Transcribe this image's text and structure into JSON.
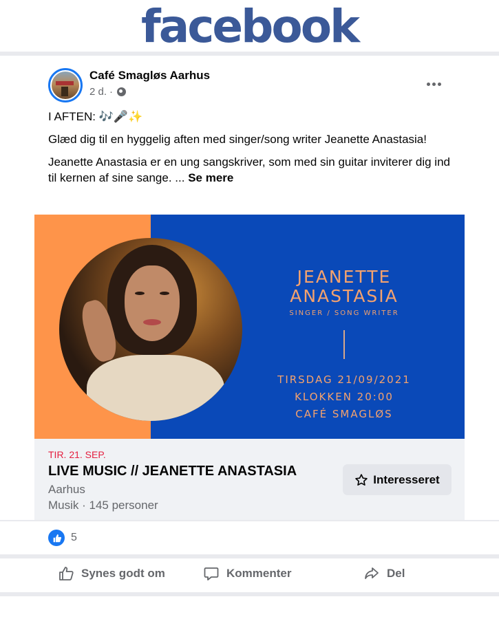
{
  "header": {
    "logo_text": "facebook",
    "logo_color": "#3b5998"
  },
  "post": {
    "page_name": "Café Smagløs Aarhus",
    "time": "2 d.",
    "separator": "·",
    "audience_icon": "globe-icon",
    "text": [
      "I AFTEN: 🎶🎤✨",
      "Glæd dig til en hyggelig aften med singer/song writer Jeanette Anastasia!",
      "Jeanette Anastasia er en ung sangskriver, som med sin guitar inviterer dig ind til kernen af sine sange. ..."
    ],
    "see_more": "Se mere"
  },
  "image": {
    "name_line1": "JEANETTE",
    "name_line2": "ANASTASIA",
    "role": "SINGER / SONG WRITER",
    "date_line": "TIRSDAG 21/09/2021",
    "time_line": "KLOKKEN 20:00",
    "place_line": "CAFÉ SMAGLØS",
    "colors": {
      "orange": "#fe944a",
      "blue": "#0a49b8",
      "text": "#f4a26e"
    }
  },
  "event": {
    "date": "TIR. 21. SEP.",
    "title": "LIVE MUSIC // JEANETTE ANASTASIA",
    "location": "Aarhus",
    "category": "Musik · 145 personer",
    "interested_label": "Interesseret"
  },
  "reactions": {
    "count": "5",
    "icon": "like-badge-icon"
  },
  "actions": {
    "like": "Synes godt om",
    "comment": "Kommenter",
    "share": "Del"
  }
}
